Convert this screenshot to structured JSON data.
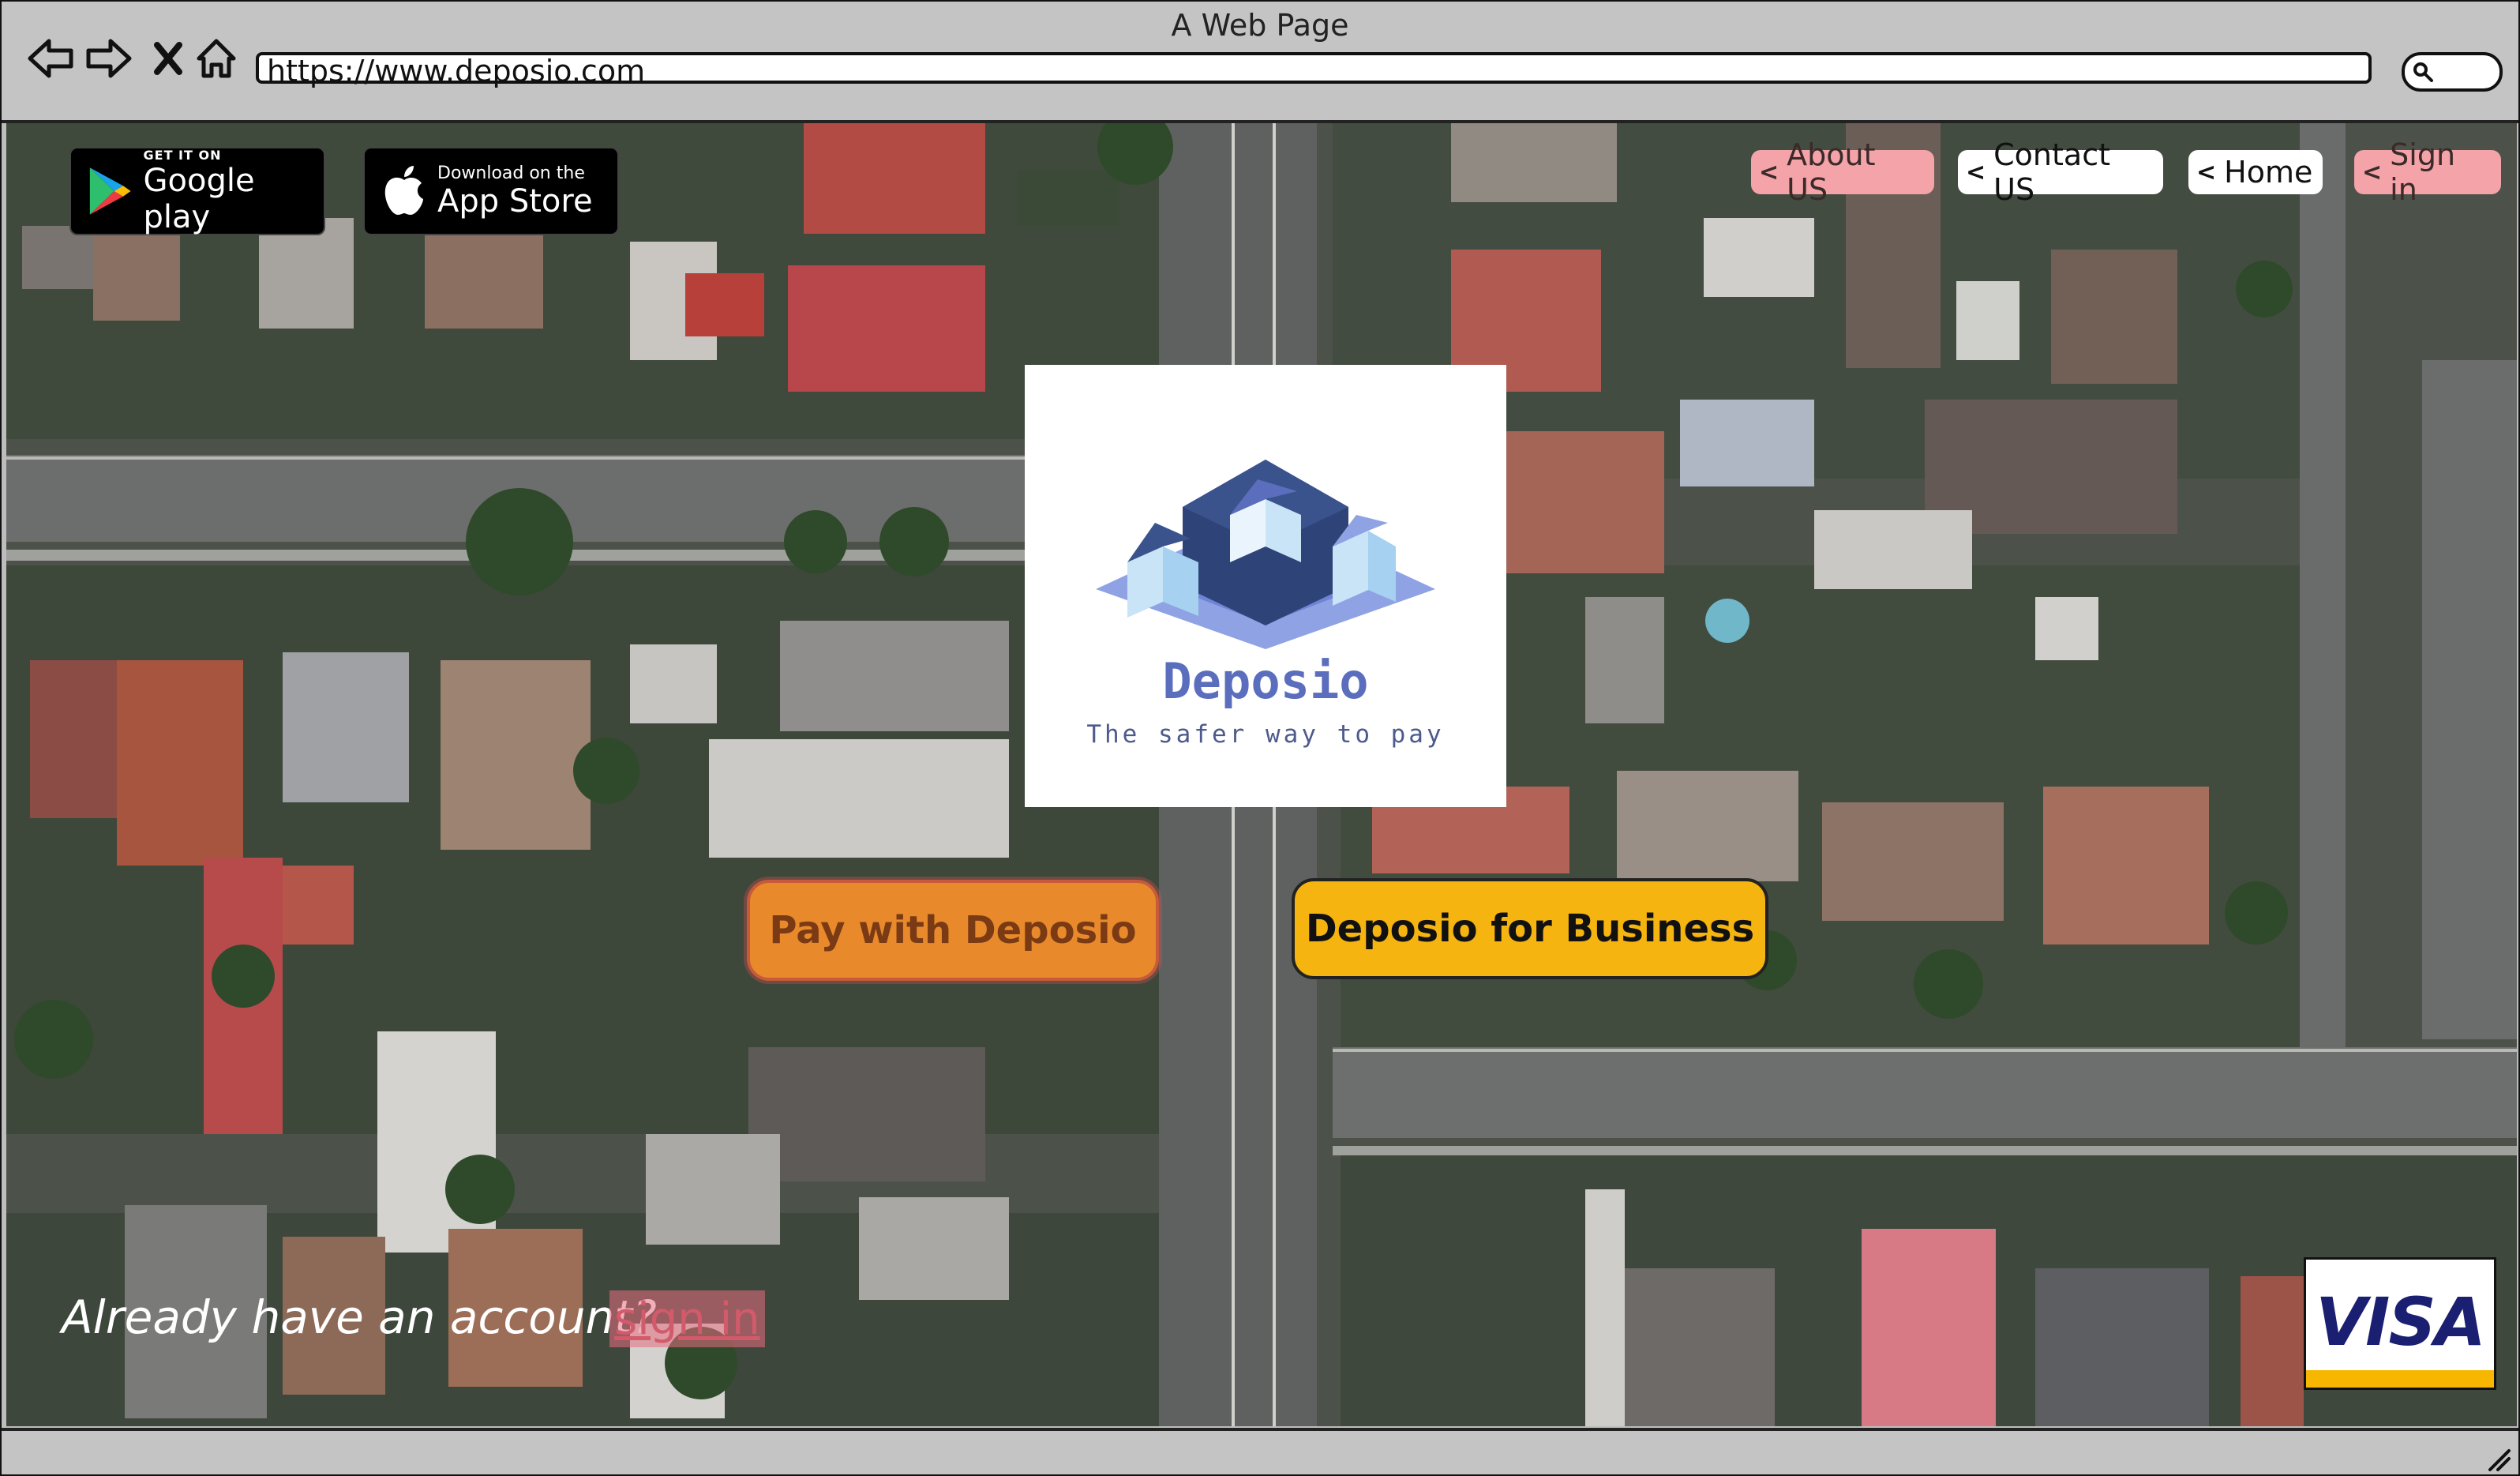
{
  "browser": {
    "title": "A Web Page",
    "url": "https://www.deposio.com"
  },
  "stores": {
    "google": {
      "small": "GET IT ON",
      "big": "Google play"
    },
    "apple": {
      "small": "Download on the",
      "big": "App Store"
    }
  },
  "nav": {
    "about": "About US",
    "contact": "Contact US",
    "home": "Home",
    "signin": "Sign in"
  },
  "brand": {
    "name": "Deposio",
    "tagline": "The safer way to pay"
  },
  "cta": {
    "pay": "Pay with Deposio",
    "business": "Deposio for Business"
  },
  "account": {
    "prompt": "Already have an account?",
    "signin": "sign in"
  },
  "payment": {
    "visa": "VISA"
  },
  "colors": {
    "nav_pink": "#f4a3a8",
    "brand_blue": "#5b6ebd",
    "pay_orange": "#e8892c",
    "business_yellow": "#f5b40f",
    "visa_navy": "#1a1f71",
    "visa_gold": "#f7b600"
  }
}
